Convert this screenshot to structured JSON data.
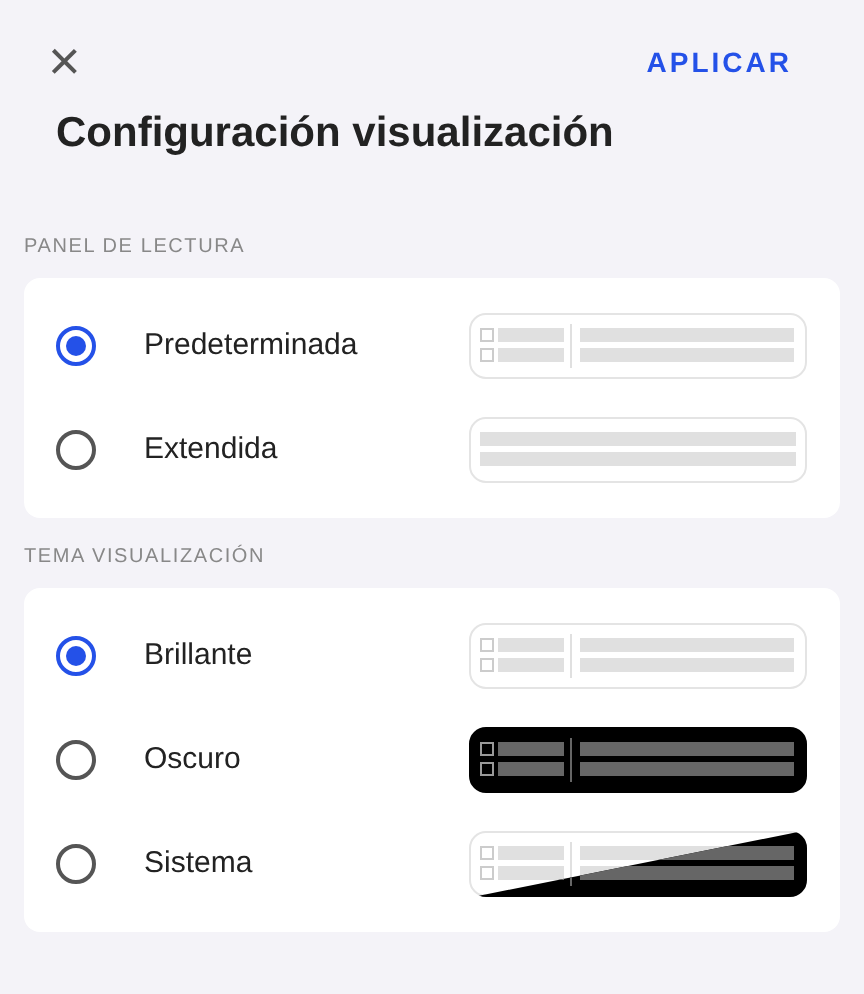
{
  "header": {
    "close": "×",
    "apply": "APLICAR"
  },
  "title": "Configuración visualización",
  "sections": [
    {
      "label": "PANEL DE LECTURA",
      "options": [
        {
          "label": "Predeterminada",
          "selected": true,
          "kind": "split"
        },
        {
          "label": "Extendida",
          "selected": false,
          "kind": "full"
        }
      ]
    },
    {
      "label": "TEMA VISUALIZACIÓN",
      "options": [
        {
          "label": "Brillante",
          "selected": true,
          "kind": "split"
        },
        {
          "label": "Oscuro",
          "selected": false,
          "kind": "dark"
        },
        {
          "label": "Sistema",
          "selected": false,
          "kind": "system"
        }
      ]
    }
  ]
}
